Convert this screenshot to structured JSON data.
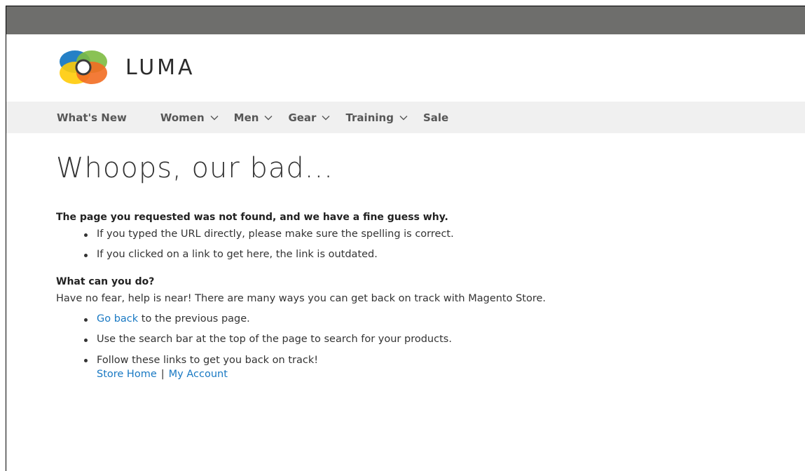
{
  "brand": {
    "name": "LUMA",
    "colors": {
      "blue": "#1979c3",
      "green": "#7dbb41",
      "orange": "#f26d22",
      "yellow": "#ffcb08",
      "nav_bg": "#f0f0f0",
      "top_bar": "#6e6e6c"
    }
  },
  "nav": {
    "items": [
      {
        "label": "What's New",
        "has_dropdown": false
      },
      {
        "label": "Women",
        "has_dropdown": true
      },
      {
        "label": "Men",
        "has_dropdown": true
      },
      {
        "label": "Gear",
        "has_dropdown": true
      },
      {
        "label": "Training",
        "has_dropdown": true
      },
      {
        "label": "Sale",
        "has_dropdown": false
      }
    ]
  },
  "page": {
    "title": "Whoops, our bad...",
    "not_found_heading": "The page you requested was not found, and we have a fine guess why.",
    "reasons": [
      "If you typed the URL directly, please make sure the spelling is correct.",
      "If you clicked on a link to get here, the link is outdated."
    ],
    "what_heading": "What can you do?",
    "intro": "Have no fear, help is near! There are many ways you can get back on track with Magento Store.",
    "go_back_link": "Go back",
    "go_back_rest": " to the previous page.",
    "search_tip": "Use the search bar at the top of the page to search for your products.",
    "follow_links": "Follow these links to get you back on track!",
    "store_home_link": "Store Home",
    "separator": "|",
    "my_account_link": "My Account"
  }
}
